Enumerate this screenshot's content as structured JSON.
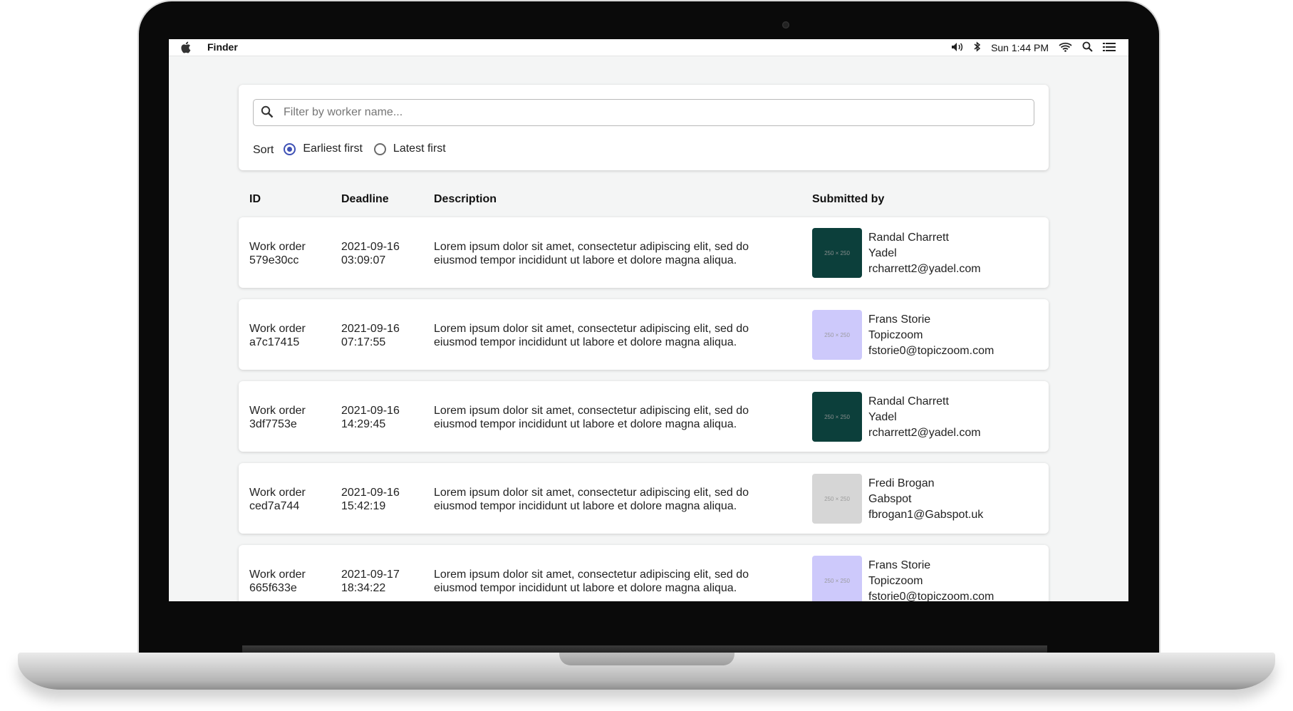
{
  "menubar": {
    "app_name": "Finder",
    "clock": "Sun 1:44 PM",
    "icons": [
      "apple-icon",
      "volume-icon",
      "bluetooth-icon",
      "wifi-icon",
      "search-icon",
      "list-icon"
    ]
  },
  "filter": {
    "search_placeholder": "Filter by worker name...",
    "search_value": "",
    "sort_label": "Sort",
    "sort_options": [
      {
        "label": "Earliest first",
        "checked": true
      },
      {
        "label": "Latest first",
        "checked": false
      }
    ]
  },
  "colors": {
    "accent": "#3f51b5",
    "avatar_dark_green": "#0c3f3b",
    "avatar_lavender": "#cdc9fb",
    "avatar_gray": "#d6d6d6"
  },
  "table": {
    "headers": {
      "id": "ID",
      "deadline": "Deadline",
      "description": "Description",
      "submitted_by": "Submitted by"
    },
    "rows": [
      {
        "id_line1": "Work order",
        "id_line2": "579e30cc",
        "deadline_date": "2021-09-16",
        "deadline_time": "03:09:07",
        "desc_line1": "Lorem ipsum dolor sit amet, consectetur adipiscing elit, sed do",
        "desc_line2": "eiusmod tempor incididunt ut labore et dolore magna aliqua.",
        "avatar_text": "250 × 250",
        "avatar_color": "#0c3f3b",
        "name": "Randal Charrett",
        "company": "Yadel",
        "email": "rcharrett2@yadel.com"
      },
      {
        "id_line1": "Work order",
        "id_line2": "a7c17415",
        "deadline_date": "2021-09-16",
        "deadline_time": "07:17:55",
        "desc_line1": "Lorem ipsum dolor sit amet, consectetur adipiscing elit, sed do",
        "desc_line2": "eiusmod tempor incididunt ut labore et dolore magna aliqua.",
        "avatar_text": "250 × 250",
        "avatar_color": "#cdc9fb",
        "name": "Frans Storie",
        "company": "Topiczoom",
        "email": "fstorie0@topiczoom.com"
      },
      {
        "id_line1": "Work order",
        "id_line2": "3df7753e",
        "deadline_date": "2021-09-16",
        "deadline_time": "14:29:45",
        "desc_line1": "Lorem ipsum dolor sit amet, consectetur adipiscing elit, sed do",
        "desc_line2": "eiusmod tempor incididunt ut labore et dolore magna aliqua.",
        "avatar_text": "250 × 250",
        "avatar_color": "#0c3f3b",
        "name": "Randal Charrett",
        "company": "Yadel",
        "email": "rcharrett2@yadel.com"
      },
      {
        "id_line1": "Work order",
        "id_line2": "ced7a744",
        "deadline_date": "2021-09-16",
        "deadline_time": "15:42:19",
        "desc_line1": "Lorem ipsum dolor sit amet, consectetur adipiscing elit, sed do",
        "desc_line2": "eiusmod tempor incididunt ut labore et dolore magna aliqua.",
        "avatar_text": "250 × 250",
        "avatar_color": "#d6d6d6",
        "name": "Fredi Brogan",
        "company": "Gabspot",
        "email": "fbrogan1@Gabspot.uk"
      },
      {
        "id_line1": "Work order",
        "id_line2": "665f633e",
        "deadline_date": "2021-09-17",
        "deadline_time": "18:34:22",
        "desc_line1": "Lorem ipsum dolor sit amet, consectetur adipiscing elit, sed do",
        "desc_line2": "eiusmod tempor incididunt ut labore et dolore magna aliqua.",
        "avatar_text": "250 × 250",
        "avatar_color": "#cdc9fb",
        "name": "Frans Storie",
        "company": "Topiczoom",
        "email": "fstorie0@topiczoom.com"
      }
    ]
  }
}
